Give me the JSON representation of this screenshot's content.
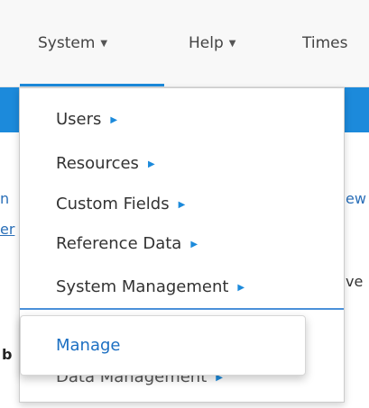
{
  "navbar": {
    "items": [
      {
        "label": "System",
        "caret": "▼"
      },
      {
        "label": "Help",
        "caret": "▼"
      },
      {
        "label": "Times"
      }
    ]
  },
  "background": {
    "fragments": [
      "n",
      "er",
      "ew",
      "ve",
      "b"
    ]
  },
  "system_menu": {
    "arrow": "▶",
    "items": [
      {
        "label": "Users"
      },
      {
        "label": "Resources"
      },
      {
        "label": "Custom Fields"
      },
      {
        "label": "Reference Data"
      },
      {
        "label": "System Management"
      },
      {
        "label": "Data Management"
      }
    ]
  },
  "submenu": {
    "items": [
      {
        "label": "Manage"
      }
    ]
  },
  "colors": {
    "accent": "#1c8adb",
    "link": "#1c6fc2",
    "divider": "#4a90d9"
  }
}
